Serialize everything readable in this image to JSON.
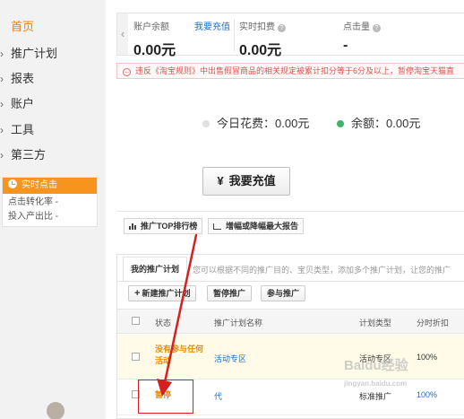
{
  "sidebar": {
    "home": "首页",
    "items": [
      {
        "label": "推广计划"
      },
      {
        "label": "报表"
      },
      {
        "label": "账户"
      },
      {
        "label": "工具"
      },
      {
        "label": "第三方"
      }
    ],
    "realtime": {
      "title": "实时点击",
      "conversion_label": "点击转化率",
      "conversion_value": "-",
      "roi_label": "投入产出比",
      "roi_value": "-"
    }
  },
  "balance_bar": {
    "account_balance_label": "账户余额",
    "recharge_link": "我要充值",
    "account_balance_value": "0.00元",
    "realtime_deduction_label": "实时扣费",
    "realtime_deduction_value": "0.00元",
    "clicks_label": "点击量",
    "clicks_value": "-"
  },
  "warning": {
    "text": "违反《淘宝规则》中出售假冒商品的相关规定被累计扣分等于6分及以上，暂停淘宝天猫直"
  },
  "spend": {
    "today_label": "今日花费：",
    "today_value": "0.00元",
    "balance_label": "余额：",
    "balance_value": "0.00元",
    "today_dot_color": "#e0e0e0",
    "balance_dot_color": "#3fb36b"
  },
  "recharge_button": {
    "icon": "¥",
    "label": "我要充值"
  },
  "report_tabs": [
    {
      "label": "推广TOP排行榜"
    },
    {
      "label": "增幅或降幅最大报告"
    }
  ],
  "plan": {
    "tab": "我的推广计划",
    "description": "您可以根据不同的推广目的、宝贝类型，添加多个推广计划，让您的推广",
    "buttons": {
      "new": "新建推广计划",
      "pause": "暂停推广",
      "join": "参与推广"
    },
    "columns": [
      "状态",
      "推广计划名称",
      "计划类型",
      "分时折扣"
    ],
    "rows": [
      {
        "status": "没有参与任何活动",
        "name": "活动专区",
        "type": "活动专区",
        "discount": "100%"
      },
      {
        "status": "暂停",
        "name": "代",
        "type": "标准推广",
        "discount": "100%"
      }
    ]
  },
  "watermark": {
    "text": "Baidu经验",
    "sub": "jingyan.baidu.com"
  },
  "colors": {
    "accent": "#f07f14",
    "link": "#1f6bbf",
    "warning": "#d9534f",
    "annotation": "#d62020"
  }
}
